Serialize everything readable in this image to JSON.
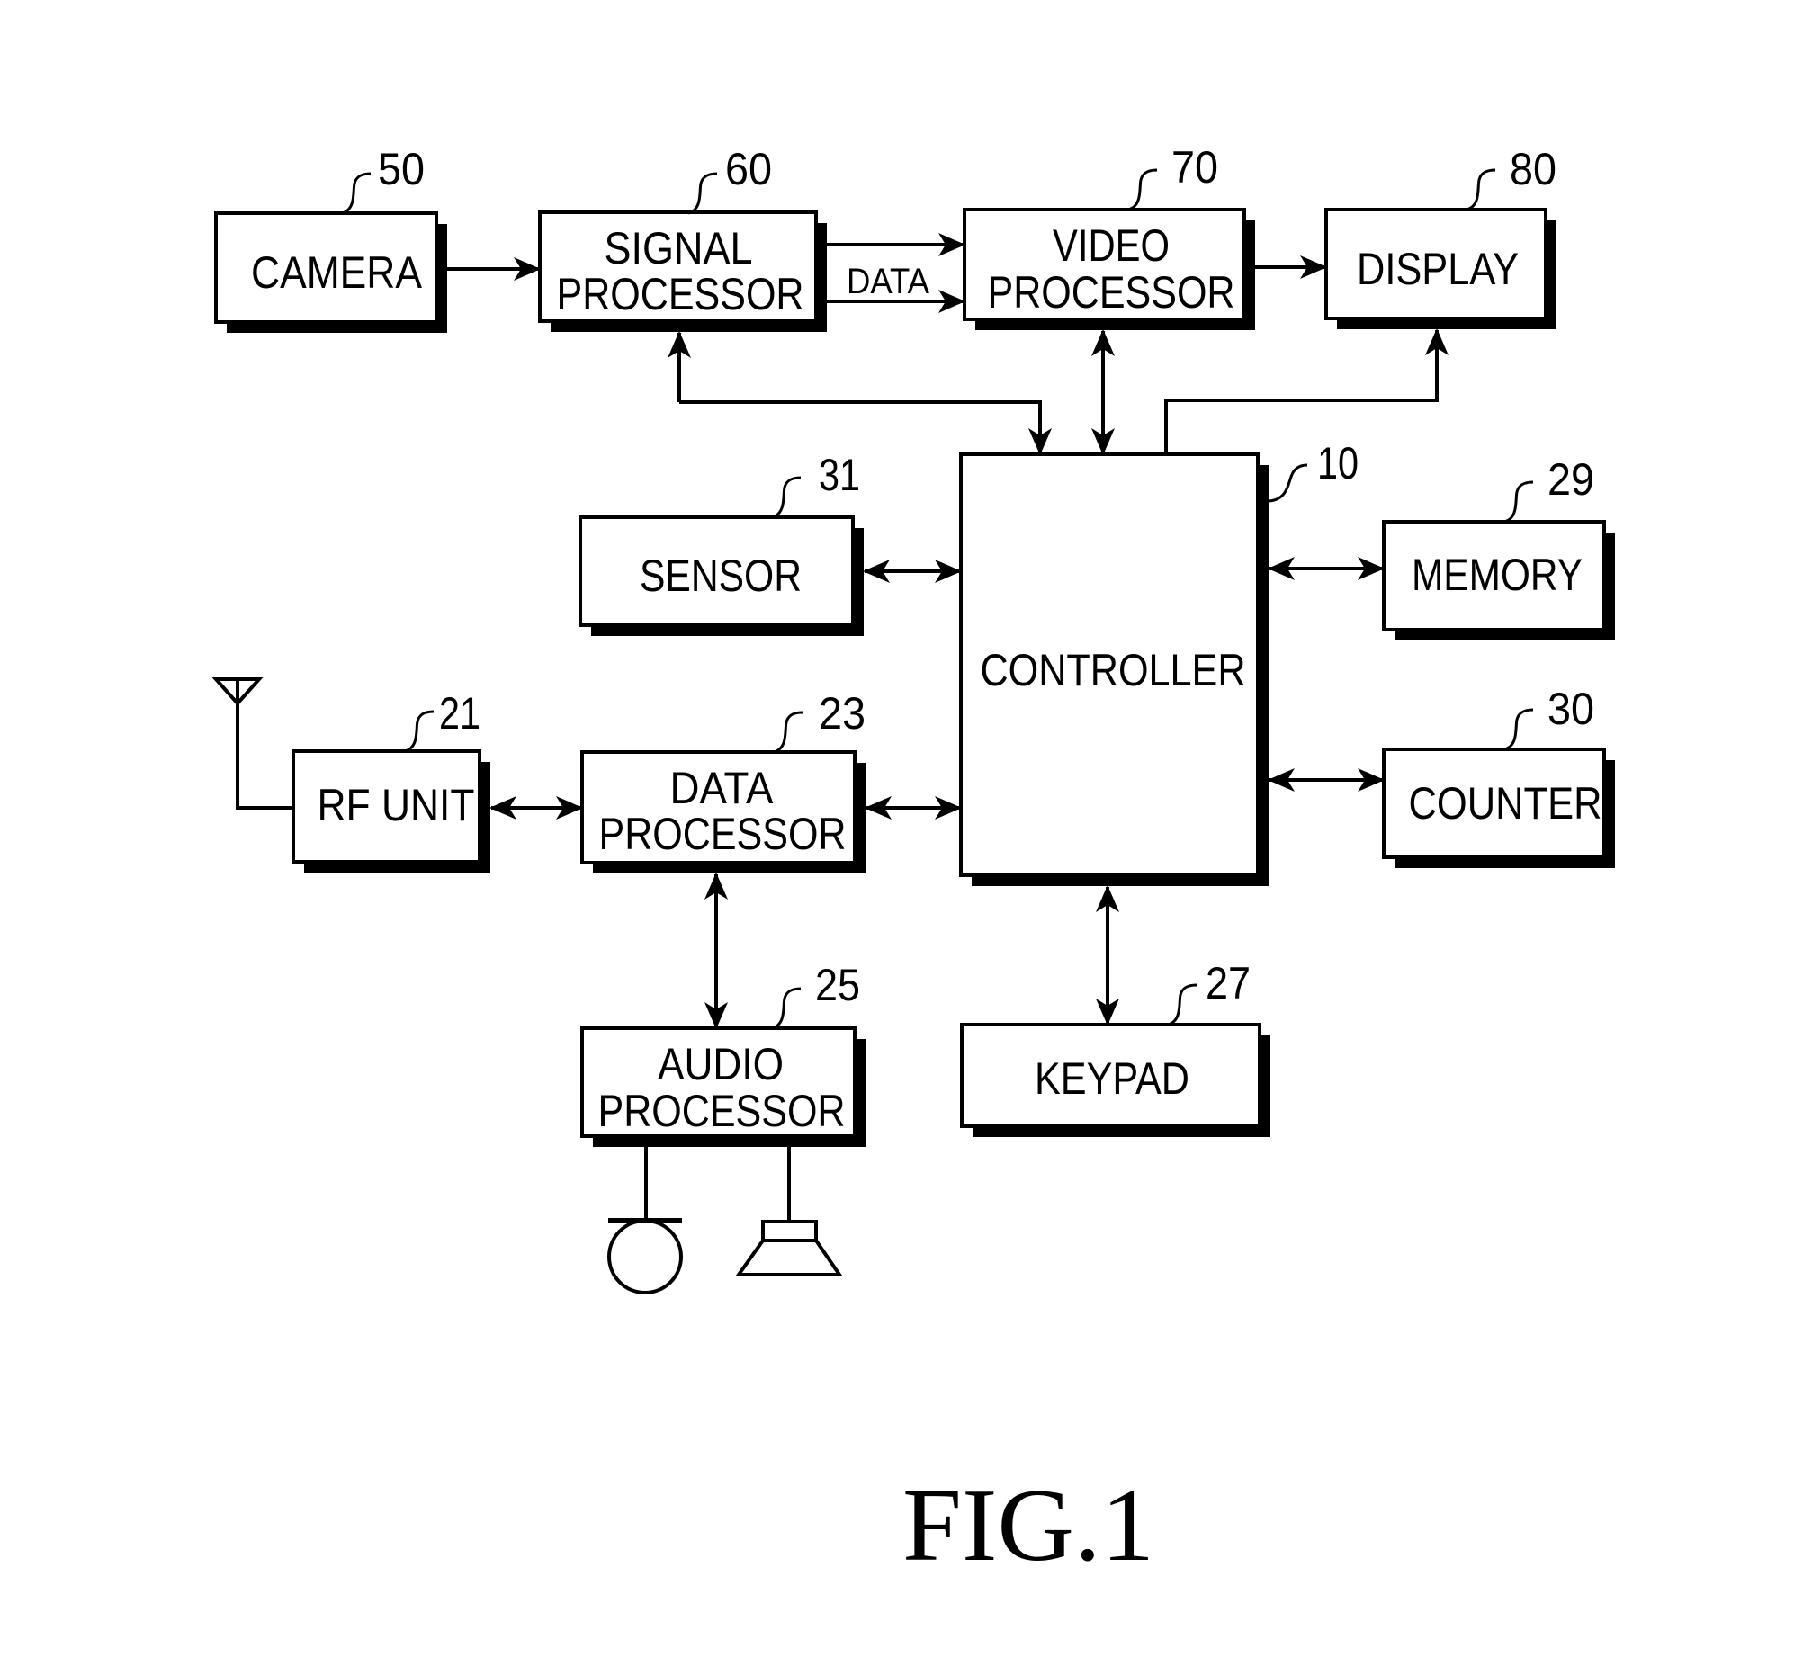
{
  "figure": {
    "caption": "FIG.1"
  },
  "blocks": {
    "camera": {
      "ref": "50",
      "lines": [
        "CAMERA"
      ]
    },
    "signal_processor": {
      "ref": "60",
      "lines": [
        "SIGNAL",
        "PROCESSOR"
      ]
    },
    "video_processor": {
      "ref": "70",
      "lines": [
        "VIDEO",
        "PROCESSOR"
      ]
    },
    "display": {
      "ref": "80",
      "lines": [
        "DISPLAY"
      ]
    },
    "controller": {
      "ref": "10",
      "lines": [
        "CONTROLLER"
      ]
    },
    "sensor": {
      "ref": "31",
      "lines": [
        "SENSOR"
      ]
    },
    "memory": {
      "ref": "29",
      "lines": [
        "MEMORY"
      ]
    },
    "rf_unit": {
      "ref": "21",
      "lines": [
        "RF UNIT"
      ]
    },
    "data_processor": {
      "ref": "23",
      "lines": [
        "DATA",
        "PROCESSOR"
      ]
    },
    "counter": {
      "ref": "30",
      "lines": [
        "COUNTER"
      ]
    },
    "audio_processor": {
      "ref": "25",
      "lines": [
        "AUDIO",
        "PROCESSOR"
      ]
    },
    "keypad": {
      "ref": "27",
      "lines": [
        "KEYPAD"
      ]
    }
  },
  "connections": {
    "data_bus_label": "DATA"
  },
  "peripherals": {
    "antenna": "antenna",
    "microphone": "microphone",
    "speaker": "speaker"
  }
}
